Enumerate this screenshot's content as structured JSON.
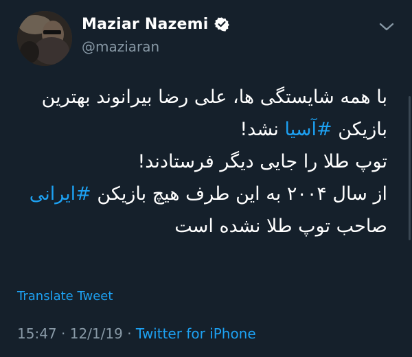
{
  "tweet": {
    "author": {
      "display_name": "Maziar Nazemi",
      "handle": "@maziaran",
      "verified": true
    },
    "text_lines": [
      {
        "before": "با همه شایستگی ها، علی رضا بیرانوند بهترین",
        "hashtag": "",
        "after": ""
      },
      {
        "before": "بازیکن ",
        "hashtag": "#آسیا",
        "after": " نشد!"
      },
      {
        "before": "توپ طلا را جایی دیگر  فرستادند!",
        "hashtag": "",
        "after": ""
      },
      {
        "before": "از سال ۲۰۰۴ به این طرف هیچ بازیکن ",
        "hashtag": "#ایرانی",
        "after": ""
      },
      {
        "before": "صاحب توپ طلا نشده است",
        "hashtag": "",
        "after": ""
      }
    ],
    "translate_label": "Translate Tweet",
    "time": "15:47",
    "separator": "·",
    "date": "12/1/19",
    "source": "Twitter for iPhone"
  },
  "colors": {
    "background": "#15202b",
    "primary_text": "#ffffff",
    "secondary_text": "#8899a6",
    "accent": "#1da1f2"
  },
  "icons": {
    "verified": "verified-badge-icon",
    "menu": "chevron-down-icon"
  }
}
